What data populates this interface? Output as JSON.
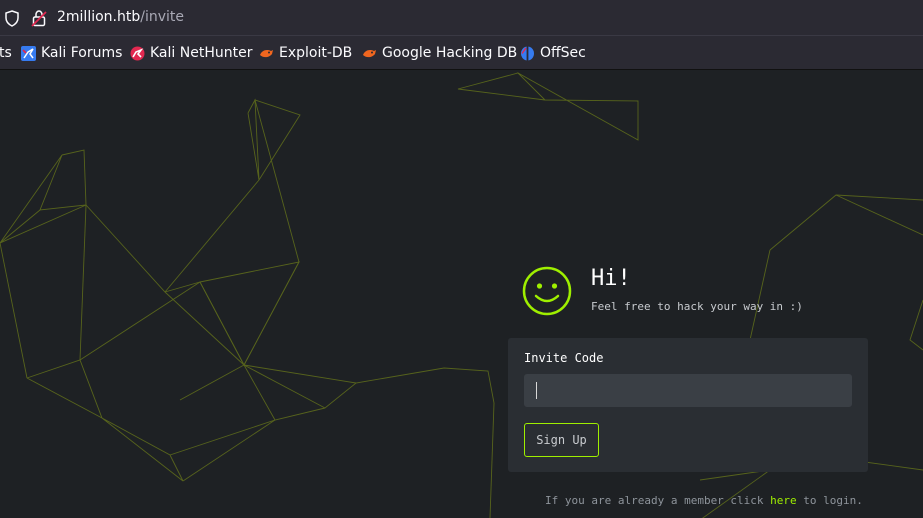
{
  "browser": {
    "url_host": "2million.htb",
    "url_path": "/invite",
    "bookmarks": [
      {
        "label": "ts",
        "icon": "bookmark-fragment-icon"
      },
      {
        "label": "Kali Forums",
        "icon": "kali-forums-icon"
      },
      {
        "label": "Kali NetHunter",
        "icon": "kali-nethunter-icon"
      },
      {
        "label": "Exploit-DB",
        "icon": "exploit-db-icon"
      },
      {
        "label": "Google Hacking DB",
        "icon": "google-hacking-db-icon"
      },
      {
        "label": "OffSec",
        "icon": "offsec-icon"
      }
    ]
  },
  "hero": {
    "greeting": "Hi!",
    "tagline": "Feel free to hack your way in :)",
    "icon": "smiley-icon"
  },
  "form": {
    "label": "Invite Code",
    "input_value": "",
    "button_label": "Sign Up"
  },
  "footer": {
    "prefix": "If you are already a member click",
    "link": "here",
    "suffix": "to login."
  },
  "colors": {
    "accent": "#9fef00",
    "background": "#1e2124",
    "card": "#2a2e33",
    "input": "#3a3f45"
  }
}
